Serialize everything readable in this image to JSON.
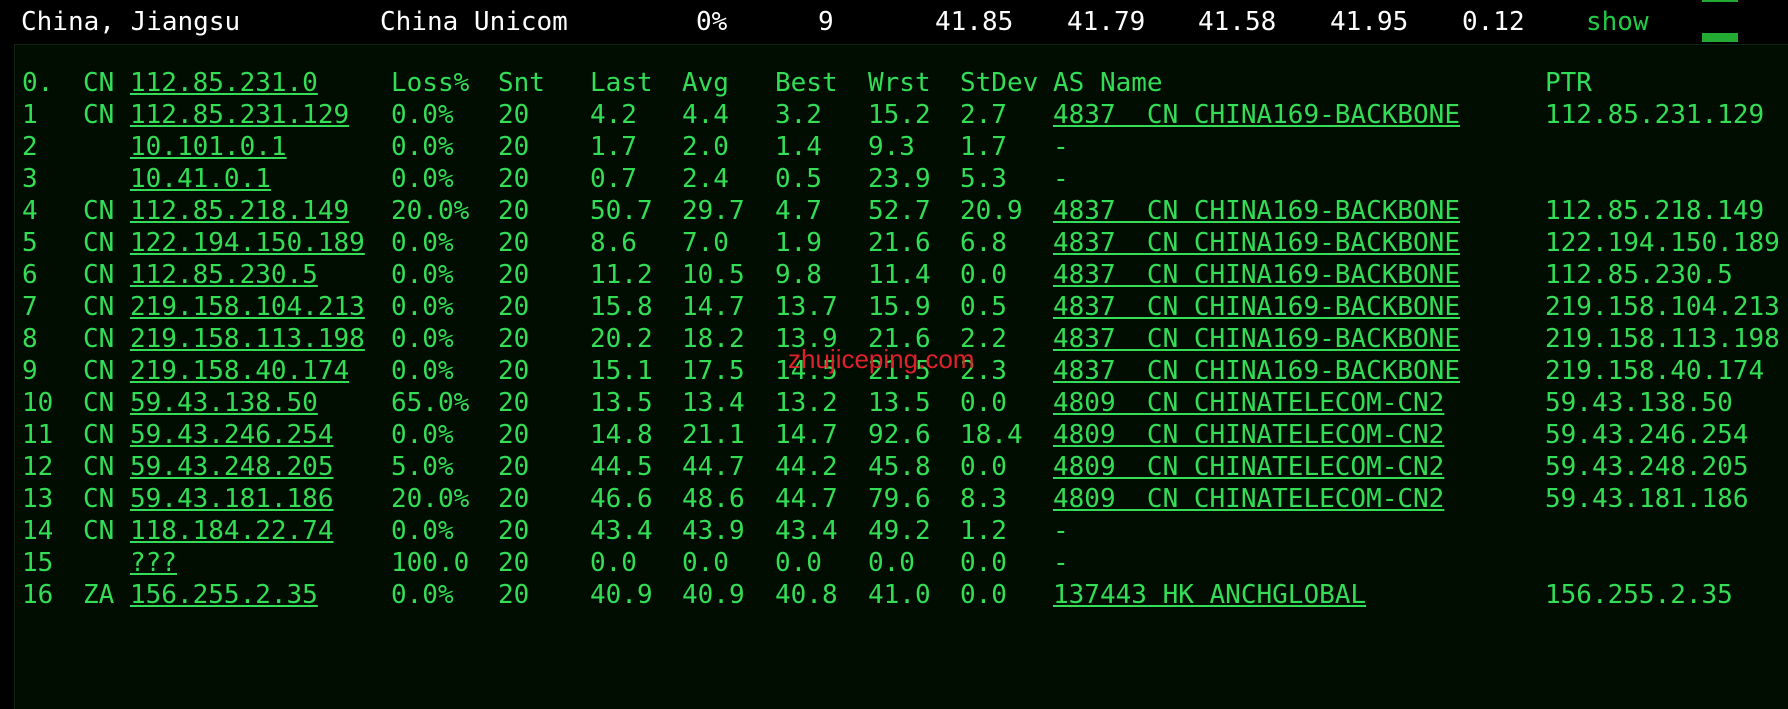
{
  "header": {
    "location": "China, Jiangsu",
    "isp": "China Unicom",
    "loss": "0%",
    "hops": "9",
    "last": "41.85",
    "avg": "41.79",
    "best": "41.58",
    "worst": "41.95",
    "stdev": "0.12",
    "show_label": "show"
  },
  "columns": {
    "hop": "0.",
    "cc": "CN",
    "host": "112.85.231.0",
    "loss": "Loss%",
    "snt": "Snt",
    "last": "Last",
    "avg": "Avg",
    "best": "Best",
    "wrst": "Wrst",
    "stdev": "StDev",
    "as_name": "AS Name",
    "ptr": "PTR"
  },
  "rows": [
    {
      "hop": "1",
      "cc": "CN",
      "host": "112.85.231.129",
      "loss": "0.0%",
      "snt": "20",
      "last": "4.2",
      "avg": "4.4",
      "best": "3.2",
      "wrst": "15.2",
      "stdev": "2.7",
      "as": "4837  CN CHINA169-BACKBONE",
      "ptr": "112.85.231.129"
    },
    {
      "hop": "2",
      "cc": "",
      "host": "10.101.0.1",
      "loss": "0.0%",
      "snt": "20",
      "last": "1.7",
      "avg": "2.0",
      "best": "1.4",
      "wrst": "9.3",
      "stdev": "1.7",
      "as": "-",
      "ptr": ""
    },
    {
      "hop": "3",
      "cc": "",
      "host": "10.41.0.1",
      "loss": "0.0%",
      "snt": "20",
      "last": "0.7",
      "avg": "2.4",
      "best": "0.5",
      "wrst": "23.9",
      "stdev": "5.3",
      "as": "-",
      "ptr": ""
    },
    {
      "hop": "4",
      "cc": "CN",
      "host": "112.85.218.149",
      "loss": "20.0%",
      "snt": "20",
      "last": "50.7",
      "avg": "29.7",
      "best": "4.7",
      "wrst": "52.7",
      "stdev": "20.9",
      "as": "4837  CN CHINA169-BACKBONE",
      "ptr": "112.85.218.149"
    },
    {
      "hop": "5",
      "cc": "CN",
      "host": "122.194.150.189",
      "loss": "0.0%",
      "snt": "20",
      "last": "8.6",
      "avg": "7.0",
      "best": "1.9",
      "wrst": "21.6",
      "stdev": "6.8",
      "as": "4837  CN CHINA169-BACKBONE",
      "ptr": "122.194.150.189"
    },
    {
      "hop": "6",
      "cc": "CN",
      "host": "112.85.230.5",
      "loss": "0.0%",
      "snt": "20",
      "last": "11.2",
      "avg": "10.5",
      "best": "9.8",
      "wrst": "11.4",
      "stdev": "0.0",
      "as": "4837  CN CHINA169-BACKBONE",
      "ptr": "112.85.230.5"
    },
    {
      "hop": "7",
      "cc": "CN",
      "host": "219.158.104.213",
      "loss": "0.0%",
      "snt": "20",
      "last": "15.8",
      "avg": "14.7",
      "best": "13.7",
      "wrst": "15.9",
      "stdev": "0.5",
      "as": "4837  CN CHINA169-BACKBONE",
      "ptr": "219.158.104.213"
    },
    {
      "hop": "8",
      "cc": "CN",
      "host": "219.158.113.198",
      "loss": "0.0%",
      "snt": "20",
      "last": "20.2",
      "avg": "18.2",
      "best": "13.9",
      "wrst": "21.6",
      "stdev": "2.2",
      "as": "4837  CN CHINA169-BACKBONE",
      "ptr": "219.158.113.198"
    },
    {
      "hop": "9",
      "cc": "CN",
      "host": "219.158.40.174",
      "loss": "0.0%",
      "snt": "20",
      "last": "15.1",
      "avg": "17.5",
      "best": "14.5",
      "wrst": "21.5",
      "stdev": "2.3",
      "as": "4837  CN CHINA169-BACKBONE",
      "ptr": "219.158.40.174"
    },
    {
      "hop": "10",
      "cc": "CN",
      "host": "59.43.138.50",
      "loss": "65.0%",
      "snt": "20",
      "last": "13.5",
      "avg": "13.4",
      "best": "13.2",
      "wrst": "13.5",
      "stdev": "0.0",
      "as": "4809  CN CHINATELECOM-CN2",
      "ptr": "59.43.138.50"
    },
    {
      "hop": "11",
      "cc": "CN",
      "host": "59.43.246.254",
      "loss": "0.0%",
      "snt": "20",
      "last": "14.8",
      "avg": "21.1",
      "best": "14.7",
      "wrst": "92.6",
      "stdev": "18.4",
      "as": "4809  CN CHINATELECOM-CN2",
      "ptr": "59.43.246.254"
    },
    {
      "hop": "12",
      "cc": "CN",
      "host": "59.43.248.205",
      "loss": "5.0%",
      "snt": "20",
      "last": "44.5",
      "avg": "44.7",
      "best": "44.2",
      "wrst": "45.8",
      "stdev": "0.0",
      "as": "4809  CN CHINATELECOM-CN2",
      "ptr": "59.43.248.205"
    },
    {
      "hop": "13",
      "cc": "CN",
      "host": "59.43.181.186",
      "loss": "20.0%",
      "snt": "20",
      "last": "46.6",
      "avg": "48.6",
      "best": "44.7",
      "wrst": "79.6",
      "stdev": "8.3",
      "as": "4809  CN CHINATELECOM-CN2",
      "ptr": "59.43.181.186"
    },
    {
      "hop": "14",
      "cc": "CN",
      "host": "118.184.22.74",
      "loss": "0.0%",
      "snt": "20",
      "last": "43.4",
      "avg": "43.9",
      "best": "43.4",
      "wrst": "49.2",
      "stdev": "1.2",
      "as": "-",
      "ptr": ""
    },
    {
      "hop": "15",
      "cc": "",
      "host": "???",
      "loss": "100.0",
      "snt": "20",
      "last": "0.0",
      "avg": "0.0",
      "best": "0.0",
      "wrst": "0.0",
      "stdev": "0.0",
      "as": "-",
      "ptr": ""
    },
    {
      "hop": "16",
      "cc": "ZA",
      "host": "156.255.2.35",
      "loss": "0.0%",
      "snt": "20",
      "last": "40.9",
      "avg": "40.9",
      "best": "40.8",
      "wrst": "41.0",
      "stdev": "0.0",
      "as": "137443 HK ANCHGLOBAL",
      "ptr": "156.255.2.35"
    }
  ],
  "watermark": "zhujiceping.com",
  "colors": {
    "terminal_text": "#33dd55",
    "header_text": "#ffffff",
    "show_link": "#22cc44",
    "watermark": "#e0202a",
    "background": "#000000"
  }
}
